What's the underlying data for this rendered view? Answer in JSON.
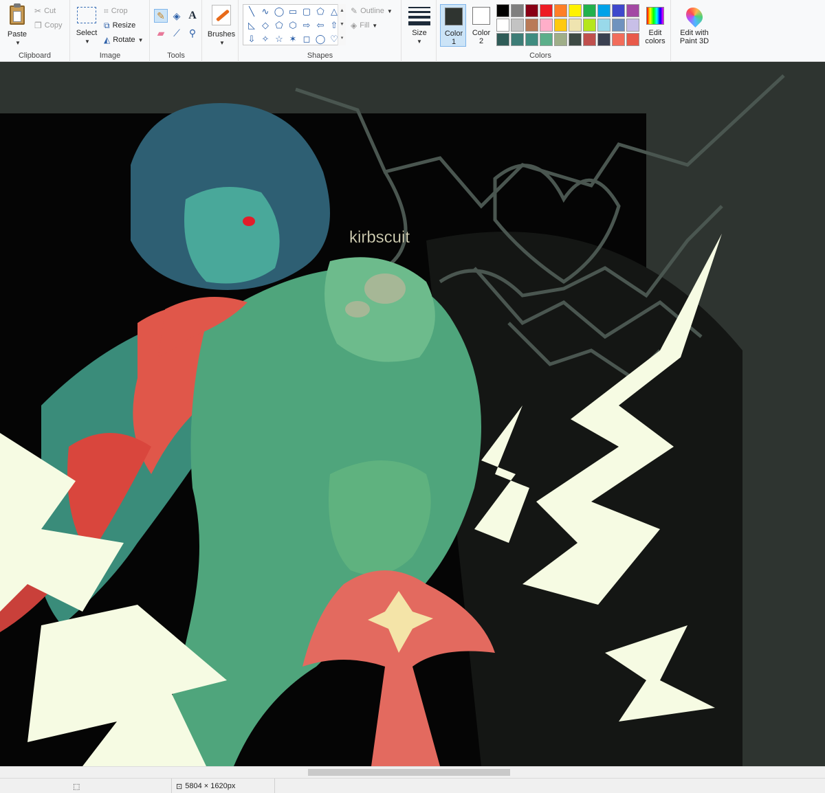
{
  "ribbon": {
    "clipboard": {
      "group_label": "Clipboard",
      "paste_label": "Paste",
      "cut_label": "Cut",
      "copy_label": "Copy"
    },
    "image": {
      "group_label": "Image",
      "select_label": "Select",
      "crop_label": "Crop",
      "resize_label": "Resize",
      "rotate_label": "Rotate"
    },
    "tools": {
      "group_label": "Tools",
      "text_tool_glyph": "A"
    },
    "brushes": {
      "label": "Brushes"
    },
    "shapes": {
      "group_label": "Shapes",
      "outline_label": "Outline",
      "fill_label": "Fill",
      "glyphs": [
        "╲",
        "∿",
        "◯",
        "▭",
        "▢",
        "⬠",
        "△",
        "◺",
        "◇",
        "⬠",
        "⬡",
        "⇨",
        "⇦",
        "⇧",
        "⇩",
        "✧",
        "☆",
        "✶",
        "◻",
        "◯",
        "♡"
      ]
    },
    "size": {
      "label": "Size"
    },
    "colors": {
      "group_label": "Colors",
      "color1_label": "Color",
      "color1_num": "1",
      "color2_label": "Color",
      "color2_num": "2",
      "color1_value": "#2f3430",
      "color2_value": "#ffffff",
      "edit_label_1": "Edit",
      "edit_label_2": "colors",
      "palette": [
        "#000000",
        "#7f7f7f",
        "#880015",
        "#ed1c24",
        "#ff7f27",
        "#fff200",
        "#22b14c",
        "#00a2e8",
        "#3f48cc",
        "#a349a4",
        "#ffffff",
        "#c3c3c3",
        "#b97a57",
        "#ffaec9",
        "#ffc90e",
        "#efe4b0",
        "#b5e61d",
        "#99d9ea",
        "#7092be",
        "#c8bfe7",
        "#2f5c58",
        "#3d7d77",
        "#3f8c80",
        "#5cae8a",
        "#9fae88",
        "#3d4a44",
        "#c0504d",
        "#3a4050",
        "#f26d5b",
        "#e85a4a"
      ]
    },
    "paint3d": {
      "label_1": "Edit with",
      "label_2": "Paint 3D"
    }
  },
  "canvas": {
    "watermark": "kirbscuit"
  },
  "statusbar": {
    "image_size": "5804 × 1620px"
  }
}
